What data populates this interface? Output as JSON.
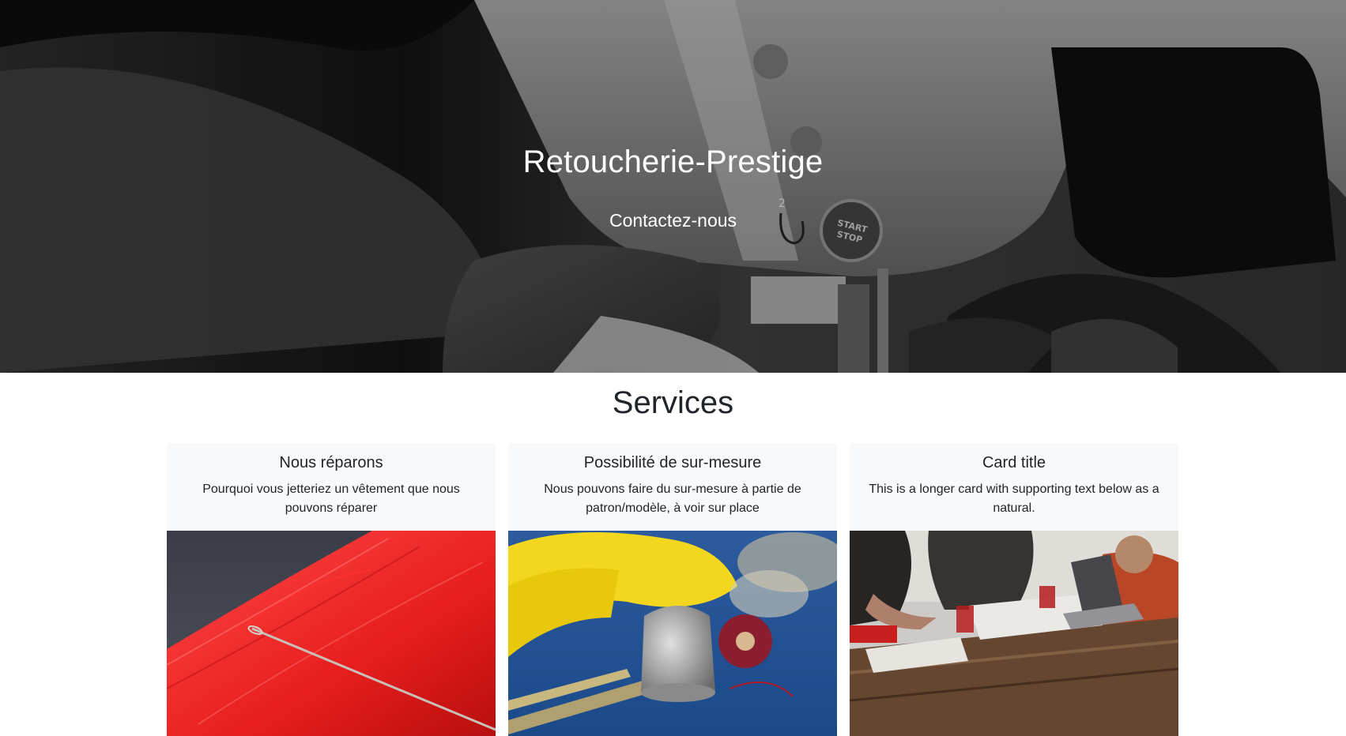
{
  "hero": {
    "title": "Retoucherie-Prestige",
    "contact_link": "Contactez-nous",
    "machine_text_top": "START",
    "machine_text_bottom": "STOP",
    "machine_number": "2"
  },
  "services": {
    "title": "Services",
    "cards": [
      {
        "title": "Nous réparons",
        "text": "Pourquoi vous jetteriez un vêtement que nous pouvons réparer",
        "image": "red-thread-needle"
      },
      {
        "title": "Possibilité de sur-mesure",
        "text": "Nous pouvons faire du sur-mesure à partie de patron/modèle, à voir sur place",
        "image": "thimble-measuring-tape"
      },
      {
        "title": "Card title",
        "text": "This is a longer card with supporting text below as a natural.",
        "image": "team-meeting-table"
      }
    ]
  }
}
